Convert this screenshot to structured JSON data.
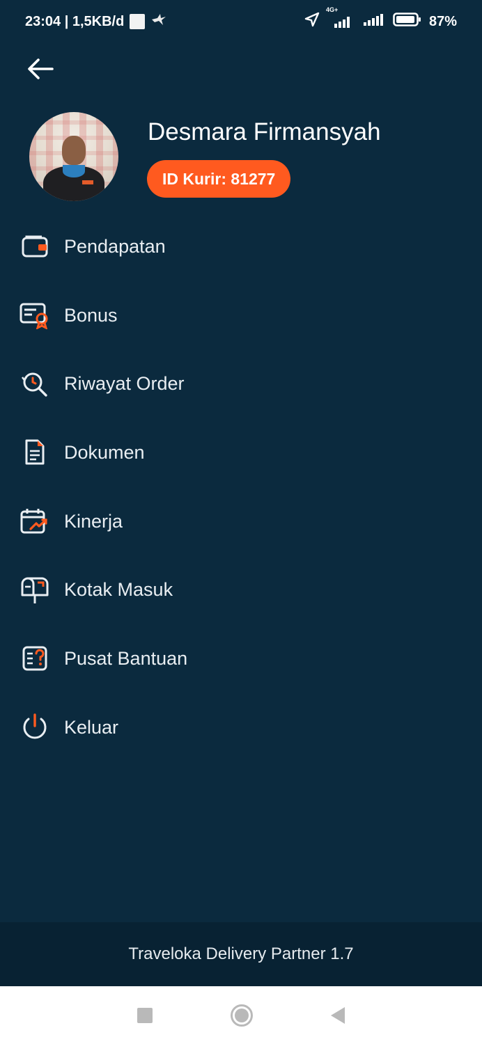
{
  "status_bar": {
    "time_info": "23:04 | 1,5KB/d",
    "network": "4G+",
    "battery": "87%"
  },
  "profile": {
    "name": "Desmara Firmansyah",
    "courier_id": "ID Kurir: 81277"
  },
  "menu": [
    {
      "label": "Pendapatan",
      "icon": "wallet-icon"
    },
    {
      "label": "Bonus",
      "icon": "bonus-card-icon"
    },
    {
      "label": "Riwayat Order",
      "icon": "history-search-icon"
    },
    {
      "label": "Dokumen",
      "icon": "document-icon"
    },
    {
      "label": "Kinerja",
      "icon": "performance-calendar-icon"
    },
    {
      "label": "Kotak Masuk",
      "icon": "mailbox-icon"
    },
    {
      "label": "Pusat Bantuan",
      "icon": "help-center-icon"
    },
    {
      "label": "Keluar",
      "icon": "power-icon"
    }
  ],
  "footer": {
    "version_text": "Traveloka Delivery Partner 1.7"
  },
  "colors": {
    "background": "#0b2a3e",
    "accent": "#ff5a1f",
    "footer_bg": "#082233"
  }
}
